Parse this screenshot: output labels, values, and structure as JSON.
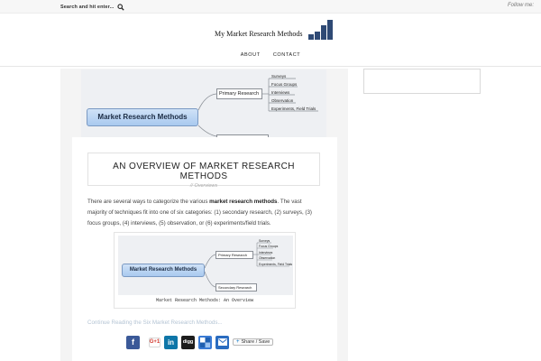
{
  "topbar": {
    "search_placeholder": "Search and hit enter...",
    "follow_text": "Follow me:"
  },
  "header": {
    "site_title": "My Market Research Methods"
  },
  "nav": {
    "items": [
      {
        "label": "ABOUT"
      },
      {
        "label": "CONTACT"
      }
    ]
  },
  "featured_diagram": {
    "root": "Market Research Methods",
    "branch": "Primary Research",
    "leaves": [
      "Surveys",
      "Focus Groups",
      "Interviews",
      "Observation",
      "Experiments, Field Trials"
    ]
  },
  "post": {
    "title": "AN OVERVIEW OF MARKET RESEARCH METHODS",
    "meta": "// Overviews",
    "excerpt_1": "There are several ways to categorize the various ",
    "excerpt_bold": "market research methods",
    "excerpt_2": ".  The vast majority of techniques fit into one of six categories: (1) secondary research, (2) surveys, (3) focus groups, (4) interviews, (5) observation, or (6) experiments/field trials.",
    "read_more": "Continue Reading the Six Market Research Methods...",
    "figure_caption": "Market Research Methods: An Overview"
  },
  "inline_diagram": {
    "root": "Market Research Methods",
    "branch_primary": "Primary Research",
    "branch_secondary": "Secondary Research",
    "leaves": [
      "Surveys",
      "Focus Groups",
      "Interviews",
      "Observation",
      "Experiments, Field Trials"
    ]
  },
  "share": {
    "gplus_label": "G+1",
    "linkedin_label": "in",
    "digg_label": "digg",
    "share_save_label": "Share / Save"
  },
  "colors": {
    "logo_bars": "#2f4a75",
    "facebook": "#3b5998",
    "linkedin": "#0e76a8",
    "read_more": "#b4c4d4"
  }
}
